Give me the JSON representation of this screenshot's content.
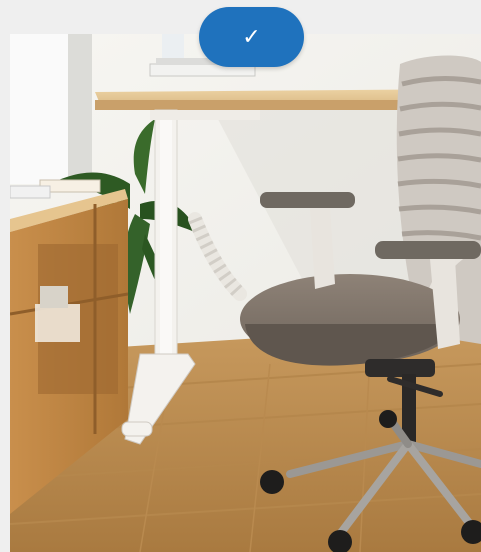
{
  "confirm_button": {
    "icon": "checkmark-icon",
    "glyph": "✓"
  },
  "photo": {
    "subject": "product-photo"
  },
  "colors": {
    "page_bg": "#efefef",
    "button_bg": "#1f72bd",
    "button_fg": "#ffffff"
  }
}
